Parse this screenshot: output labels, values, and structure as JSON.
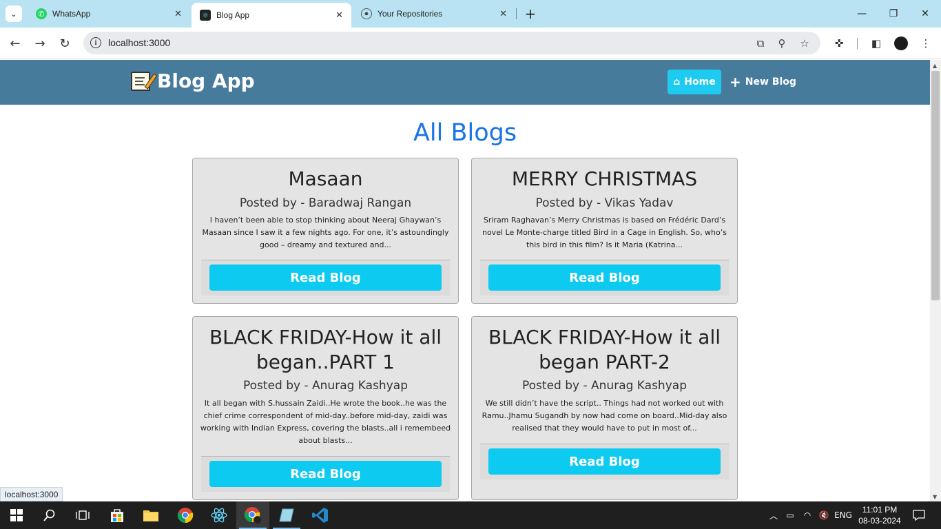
{
  "browser": {
    "tabs": [
      {
        "title": "WhatsApp",
        "icon": "whatsapp-icon"
      },
      {
        "title": "Blog App",
        "icon": "react-icon"
      },
      {
        "title": "Your Repositories",
        "icon": "github-icon"
      }
    ],
    "url": "localhost:3000",
    "status_url": "localhost:3000"
  },
  "app": {
    "brand": "Blog App",
    "nav": {
      "home": "Home",
      "new_blog": "New Blog"
    },
    "page_title": "All Blogs",
    "read_label": "Read Blog",
    "blogs": [
      {
        "title": "Masaan",
        "author": "Posted by - Baradwaj Rangan",
        "excerpt": "I haven’t been able to stop thinking about Neeraj Ghaywan’s Masaan since I saw it a few nights ago. For one, it’s astoundingly good – dreamy and textured and..."
      },
      {
        "title": "MERRY CHRISTMAS",
        "author": "Posted by - Vikas Yadav",
        "excerpt": "Sriram Raghavan’s Merry Christmas is based on Frédéric Dard’s novel Le Monte-charge titled Bird in a Cage in English. So, who’s this bird in this film? Is it Maria (Katrina..."
      },
      {
        "title": "BLACK FRIDAY-How it all began..PART 1",
        "author": "Posted by - Anurag Kashyap",
        "excerpt": "It all began with S.hussain Zaidi..He wrote the book..he was the chief crime correspondent of mid-day..before mid-day, zaidi was working with Indian Express, covering the blasts..all i remembeed about blasts..."
      },
      {
        "title": "BLACK FRIDAY-How it all began PART-2",
        "author": "Posted by - Anurag Kashyap",
        "excerpt": "We still didn’t have the script.. Things had not worked out with Ramu..Jhamu Sugandh by now had come on board..Mid-day also realised that they would have to put in most of..."
      }
    ]
  },
  "taskbar": {
    "language": "ENG",
    "time": "11:01 PM",
    "date": "08-03-2024"
  },
  "colors": {
    "navbar": "#477b9c",
    "accent": "#0dcaf0",
    "title": "#1a73e8"
  }
}
